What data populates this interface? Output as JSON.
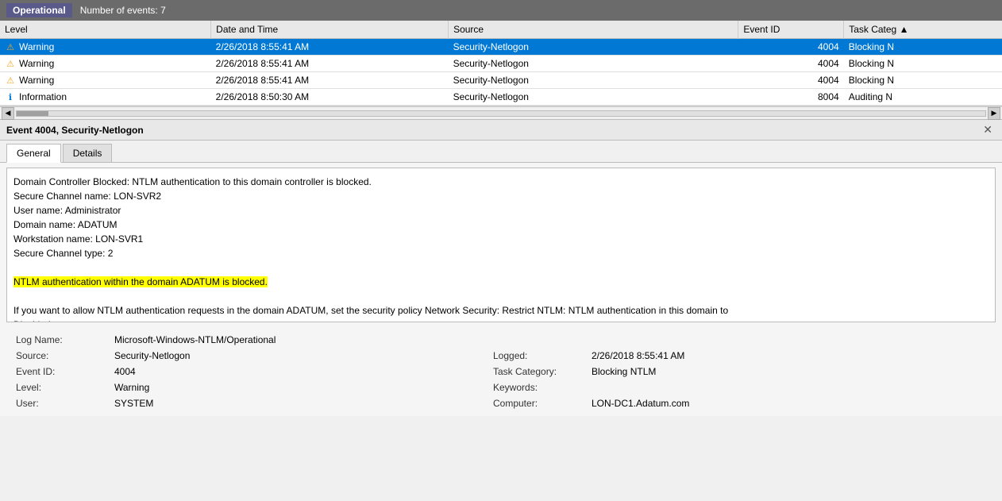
{
  "topbar": {
    "label": "Operational",
    "event_count_label": "Number of events: 7"
  },
  "table": {
    "headers": [
      "Level",
      "Date and Time",
      "Source",
      "Event ID",
      "Task Categ"
    ],
    "rows": [
      {
        "level": "Warning",
        "level_type": "warning",
        "datetime": "2/26/2018 8:55:41 AM",
        "source": "Security-Netlogon",
        "event_id": "4004",
        "task_category": "Blocking N",
        "selected": true
      },
      {
        "level": "Warning",
        "level_type": "warning",
        "datetime": "2/26/2018 8:55:41 AM",
        "source": "Security-Netlogon",
        "event_id": "4004",
        "task_category": "Blocking N",
        "selected": false
      },
      {
        "level": "Warning",
        "level_type": "warning",
        "datetime": "2/26/2018 8:55:41 AM",
        "source": "Security-Netlogon",
        "event_id": "4004",
        "task_category": "Blocking N",
        "selected": false
      },
      {
        "level": "Information",
        "level_type": "info",
        "datetime": "2/26/2018 8:50:30 AM",
        "source": "Security-Netlogon",
        "event_id": "8004",
        "task_category": "Auditing N",
        "selected": false
      }
    ]
  },
  "detail_panel": {
    "title": "Event 4004, Security-Netlogon",
    "tabs": [
      {
        "label": "General",
        "active": true
      },
      {
        "label": "Details",
        "active": false
      }
    ],
    "message_lines": [
      "Domain Controller Blocked: NTLM authentication to this domain controller is blocked.",
      "Secure Channel name: LON-SVR2",
      "User name: Administrator",
      "Domain name: ADATUM",
      "Workstation name: LON-SVR1",
      "Secure Channel type: 2",
      "",
      "NTLM authentication within the domain ADATUM is blocked.",
      "",
      "If you want to allow NTLM authentication requests in the domain ADATUM, set the security policy Network Security: Restrict NTLM: NTLM authentication in this domain to",
      "Disabled."
    ],
    "highlighted_line": "NTLM authentication within the domain ADATUM is blocked.",
    "metadata": {
      "log_name_label": "Log Name:",
      "log_name_value": "Microsoft-Windows-NTLM/Operational",
      "source_label": "Source:",
      "source_value": "Security-Netlogon",
      "logged_label": "Logged:",
      "logged_value": "2/26/2018 8:55:41 AM",
      "event_id_label": "Event ID:",
      "event_id_value": "4004",
      "task_category_label": "Task Category:",
      "task_category_value": "Blocking NTLM",
      "level_label": "Level:",
      "level_value": "Warning",
      "keywords_label": "Keywords:",
      "keywords_value": "",
      "user_label": "User:",
      "user_value": "SYSTEM",
      "computer_label": "Computer:",
      "computer_value": "LON-DC1.Adatum.com"
    }
  }
}
